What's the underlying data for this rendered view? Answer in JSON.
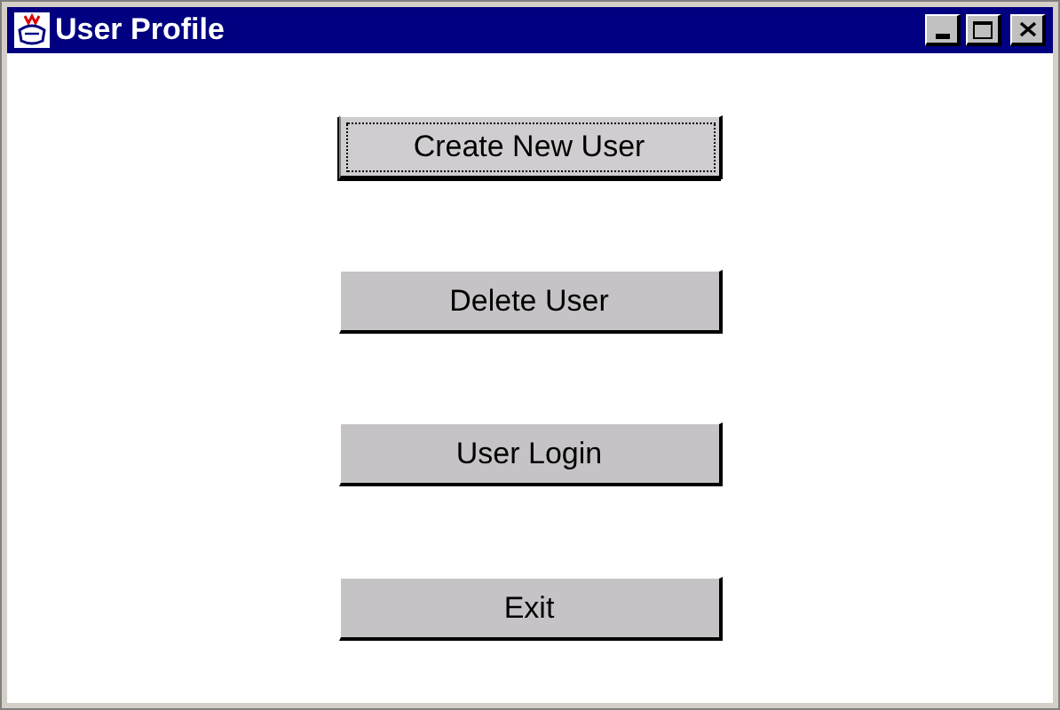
{
  "window": {
    "title": "User Profile"
  },
  "buttons": [
    {
      "label": "Create New User",
      "focused": true
    },
    {
      "label": "Delete User",
      "focused": false
    },
    {
      "label": "User Login",
      "focused": false
    },
    {
      "label": "Exit",
      "focused": false
    }
  ]
}
